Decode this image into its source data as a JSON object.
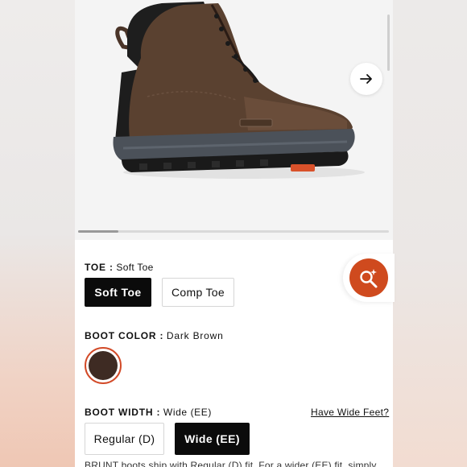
{
  "toe": {
    "label": "TOE :",
    "selected_value": "Soft Toe",
    "options": [
      "Soft Toe",
      "Comp Toe"
    ]
  },
  "color": {
    "label": "BOOT COLOR :",
    "selected_value": "Dark Brown",
    "swatch_hex": "#3e2b23"
  },
  "width": {
    "label": "BOOT WIDTH :",
    "selected_value": "Wide (EE)",
    "options": [
      "Regular (D)",
      "Wide (EE)"
    ],
    "help_link": "Have Wide Feet?"
  },
  "gallery": {
    "scroll_progress": 0.13
  },
  "note_text": "BRUNT boots ship with Regular (D) fit. For a wider (EE) fit, simply",
  "colors": {
    "accent": "#cf4a1e",
    "selected_bg": "#0b0b0b",
    "panel_bg": "#ffffff"
  },
  "icons": {
    "next": "arrow-right-icon",
    "zoom": "magnifier-sparkle-icon"
  }
}
